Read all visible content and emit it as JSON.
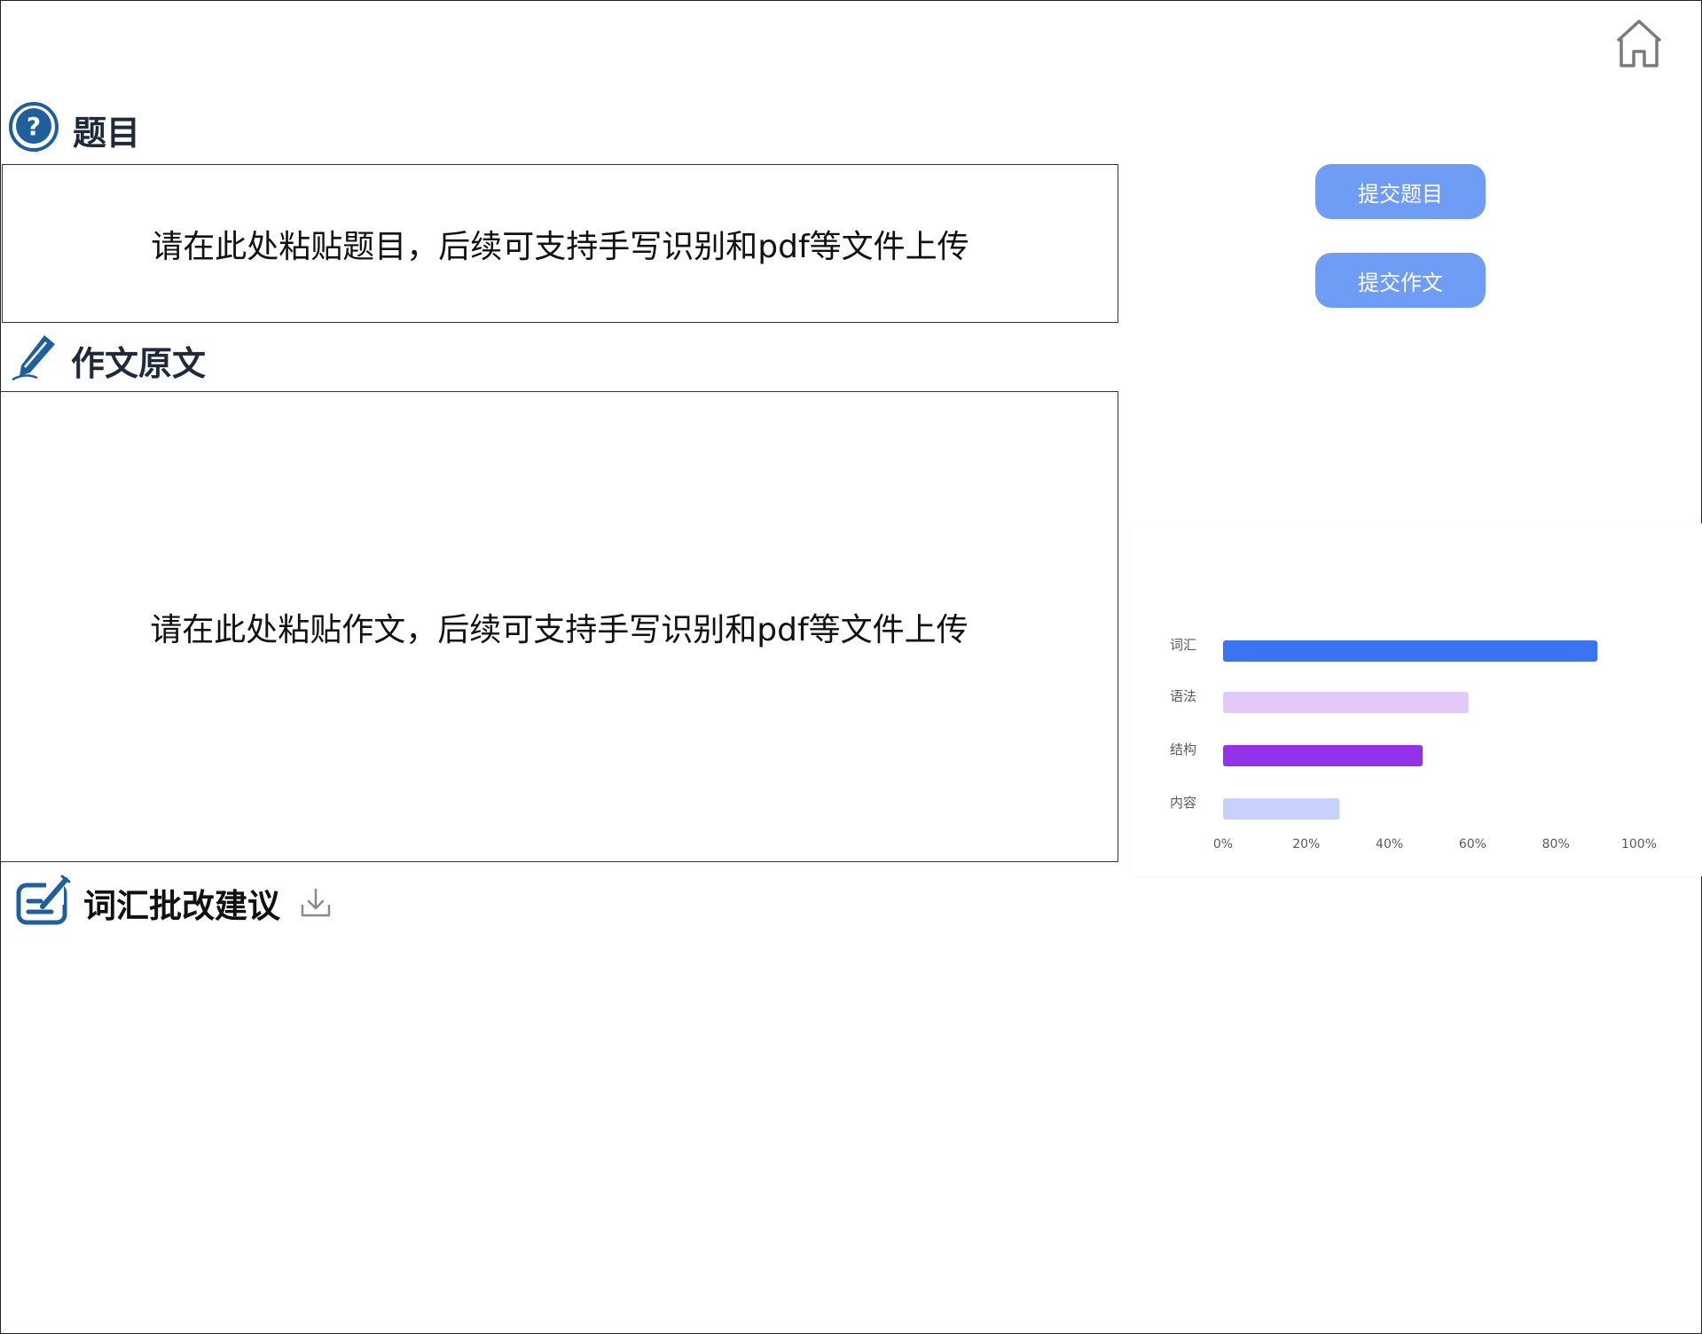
{
  "header": {
    "home_icon": "home-icon"
  },
  "sections": {
    "topic": {
      "icon": "question-icon",
      "title": "题目"
    },
    "essay": {
      "icon": "pen-icon",
      "title": "作文原文"
    },
    "vocab": {
      "icon": "edit-sign-icon",
      "title": "词汇批改建议",
      "download_icon": "download-icon"
    }
  },
  "inputs": {
    "topic_placeholder": "请在此处粘贴题目，后续可支持手写识别和pdf等文件上传",
    "essay_placeholder": "请在此处粘贴作文，后续可支持手写识别和pdf等文件上传"
  },
  "buttons": {
    "submit_topic": "提交题目",
    "submit_essay": "提交作文"
  },
  "colors": {
    "button": "#6f9df5",
    "icon_blue": "#1f5f9e",
    "bar_vocab": "#3a74f0",
    "bar_grammar": "#e3c8fa",
    "bar_structure": "#9332ea",
    "bar_content": "#c7d2fb"
  },
  "chart_data": {
    "type": "bar",
    "orientation": "horizontal",
    "categories": [
      "词汇",
      "语法",
      "结构",
      "内容"
    ],
    "values": [
      90,
      59,
      48,
      28
    ],
    "colors": [
      "#3a74f0",
      "#e3c8fa",
      "#9332ea",
      "#c7d2fb"
    ],
    "xlim": [
      0,
      100
    ],
    "x_ticks": [
      "0%",
      "20%",
      "40%",
      "60%",
      "80%",
      "100%"
    ],
    "grid": false,
    "legend": "none",
    "title": "",
    "xlabel": "",
    "ylabel": ""
  }
}
